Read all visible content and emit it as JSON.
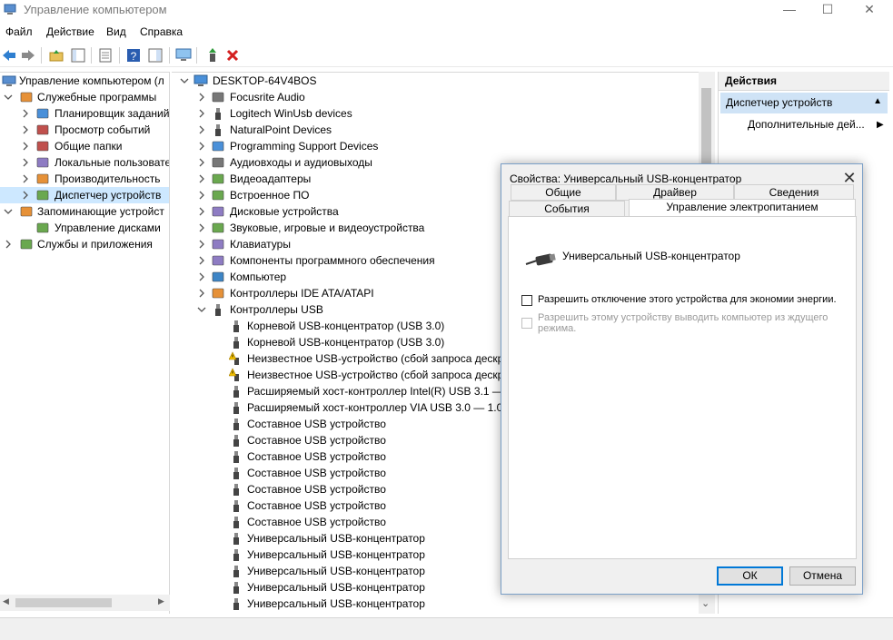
{
  "window": {
    "title": "Управление компьютером",
    "controls": {
      "minimize": "—",
      "maximize": "☐",
      "close": "✕"
    }
  },
  "menu": [
    "Файл",
    "Действие",
    "Вид",
    "Справка"
  ],
  "left_tree": {
    "root": "Управление компьютером (л",
    "items": [
      {
        "label": "Служебные программы",
        "icon": "tools-icon",
        "level": 1,
        "expanded": true
      },
      {
        "label": "Планировщик заданий",
        "icon": "clock-icon",
        "level": 2
      },
      {
        "label": "Просмотр событий",
        "icon": "event-viewer-icon",
        "level": 2
      },
      {
        "label": "Общие папки",
        "icon": "shared-folder-icon",
        "level": 2
      },
      {
        "label": "Локальные пользовате",
        "icon": "users-icon",
        "level": 2
      },
      {
        "label": "Производительность",
        "icon": "performance-icon",
        "level": 2
      },
      {
        "label": "Диспетчер устройств",
        "icon": "device-manager-icon",
        "level": 2,
        "selected": true
      },
      {
        "label": "Запоминающие устройст",
        "icon": "storage-icon",
        "level": 1,
        "expanded": true
      },
      {
        "label": "Управление дисками",
        "icon": "disk-icon",
        "level": 2
      },
      {
        "label": "Службы и приложения",
        "icon": "services-icon",
        "level": 1
      }
    ]
  },
  "device_tree": {
    "computer": "DESKTOP-64V4BOS",
    "categories": [
      "Focusrite Audio",
      "Logitech WinUsb devices",
      "NaturalPoint Devices",
      "Programming Support Devices",
      "Аудиовходы и аудиовыходы",
      "Видеоадаптеры",
      "Встроенное ПО",
      "Дисковые устройства",
      "Звуковые, игровые и видеоустройства",
      "Клавиатуры",
      "Компоненты программного обеспечения",
      "Компьютер",
      "Контроллеры IDE ATA/ATAPI",
      "Контроллеры USB"
    ],
    "usb_children": [
      {
        "label": "Корневой USB-концентратор (USB 3.0)",
        "warning": false
      },
      {
        "label": "Корневой USB-концентратор (USB 3.0)",
        "warning": false
      },
      {
        "label": "Неизвестное USB-устройство (сбой запроса дескри",
        "warning": true
      },
      {
        "label": "Неизвестное USB-устройство (сбой запроса дескри",
        "warning": true
      },
      {
        "label": "Расширяемый хост-контроллер Intel(R) USB 3.1 —",
        "warning": false
      },
      {
        "label": "Расширяемый хост-контроллер VIA USB 3.0 — 1.0",
        "warning": false
      },
      {
        "label": "Составное USB устройство",
        "warning": false
      },
      {
        "label": "Составное USB устройство",
        "warning": false
      },
      {
        "label": "Составное USB устройство",
        "warning": false
      },
      {
        "label": "Составное USB устройство",
        "warning": false
      },
      {
        "label": "Составное USB устройство",
        "warning": false
      },
      {
        "label": "Составное USB устройство",
        "warning": false
      },
      {
        "label": "Составное USB устройство",
        "warning": false
      },
      {
        "label": "Универсальный USB-концентратор",
        "warning": false
      },
      {
        "label": "Универсальный USB-концентратор",
        "warning": false
      },
      {
        "label": "Универсальный USB-концентратор",
        "warning": false
      },
      {
        "label": "Универсальный USB-концентратор",
        "warning": false
      },
      {
        "label": "Универсальный USB-концентратор",
        "warning": false
      }
    ]
  },
  "actions": {
    "header": "Действия",
    "section": "Диспетчер устройств",
    "more": "Дополнительные дей..."
  },
  "dialog": {
    "title": "Свойства: Универсальный USB-концентратор",
    "tabs_row1": [
      "Общие",
      "Драйвер",
      "Сведения"
    ],
    "tabs_row2": [
      "События",
      "Управление электропитанием"
    ],
    "active_tab": "Управление электропитанием",
    "device_name": "Универсальный USB-концентратор",
    "option1": "Разрешить отключение этого устройства для экономии энергии.",
    "option1_checked": false,
    "option2_line1": "Разрешить этому устройству выводить компьютер из ждущего",
    "option2_line2": "режима.",
    "option2_enabled": false,
    "ok": "ОК",
    "cancel": "Отмена"
  }
}
